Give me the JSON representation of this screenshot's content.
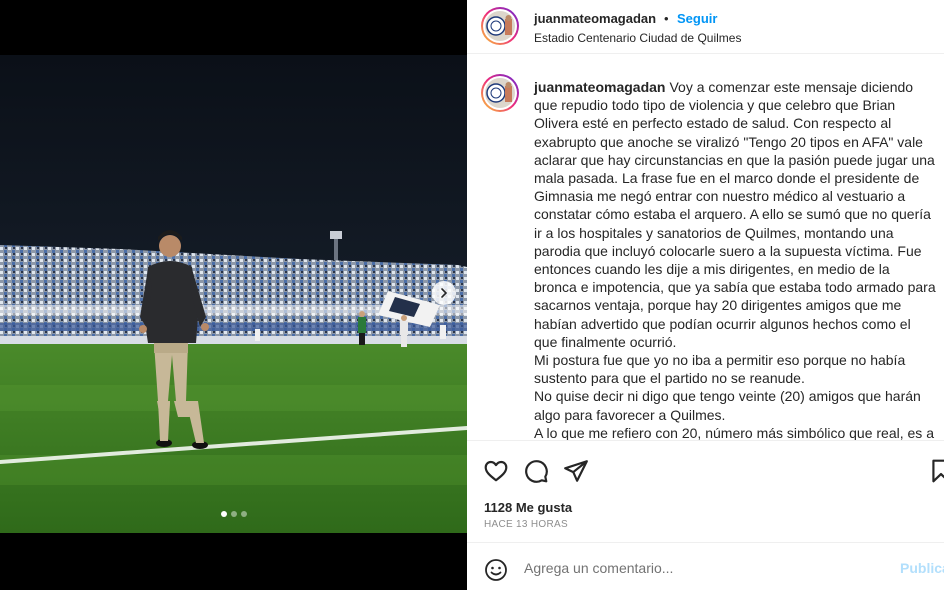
{
  "post": {
    "username": "juanmateomagadan",
    "separator": "•",
    "follow_label": "Seguir",
    "location": "Estadio Centenario Ciudad de Quilmes",
    "caption_text": "Voy a comenzar este mensaje diciendo que repudio todo tipo de violencia y que celebro que Brian Olivera esté en perfecto estado de salud. Con respecto al exabrupto que anoche se viralizó \"Tengo 20 tipos en AFA\" vale aclarar que hay circunstancias en que la pasión puede jugar una mala pasada. La frase fue en el marco donde el presidente de Gimnasia me negó entrar con nuestro médico al vestuario a constatar cómo estaba el arquero. A ello se sumó que no quería ir a los hospitales y sanatorios de Quilmes, montando una parodia que incluyó colocarle suero a la supuesta víctima. Fue entonces cuando les dije a mis dirigentes, en medio de la bronca e impotencia, que ya sabía que estaba todo armado para sacarnos ventaja, porque hay 20 dirigentes amigos que me habían advertido que podían ocurrir algunos hechos como el que finalmente ocurrió.\nMi postura fue que yo no iba a permitir eso porque no había sustento para que el partido no se reanude.\nNo quise decir ni digo que tengo veinte (20) amigos que harán algo para favorecer a Quilmes.\nA lo que me refiero con 20, número más simbólico que real, es a las advertencias que había recibido, y yo no me iba a quedar",
    "likes": "1128 Me gusta",
    "time_ago": "HACE 13 HORAS"
  },
  "comment": {
    "placeholder": "Agrega un comentario...",
    "publish_label": "Publicar"
  },
  "carousel": {
    "total": 3,
    "current": 1
  },
  "colors": {
    "accent": "#0095f6",
    "text": "#262626",
    "muted": "#8e8e8e",
    "publish_disabled": "#b2dffc"
  }
}
